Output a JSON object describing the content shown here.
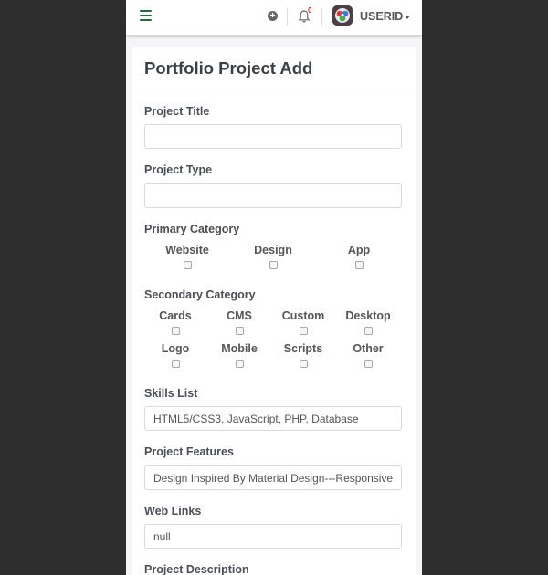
{
  "navbar": {
    "menu_icon": "hamburger-icon",
    "add_icon": "plus-circle-icon",
    "bell_icon": "bell-icon",
    "notification_count": "0",
    "user_label": "USERID",
    "accent_color": "#1f6f3e",
    "badge_color": "#d62b2b"
  },
  "form": {
    "title": "Portfolio Project Add",
    "project_title": {
      "label": "Project Title",
      "value": ""
    },
    "project_type": {
      "label": "Project Type",
      "value": ""
    },
    "primary_category": {
      "label": "Primary Category",
      "options": [
        "Website",
        "Design",
        "App"
      ]
    },
    "secondary_category": {
      "label": "Secondary Category",
      "options": [
        "Cards",
        "CMS",
        "Custom",
        "Desktop",
        "Logo",
        "Mobile",
        "Scripts",
        "Other"
      ]
    },
    "skills_list": {
      "label": "Skills List",
      "value": "HTML5/CSS3, JavaScript, PHP, Database"
    },
    "project_features": {
      "label": "Project Features",
      "value": "Design Inspired By Material Design---Responsive"
    },
    "web_links": {
      "label": "Web Links",
      "value": "null"
    },
    "project_description": {
      "label": "Project Description"
    }
  }
}
